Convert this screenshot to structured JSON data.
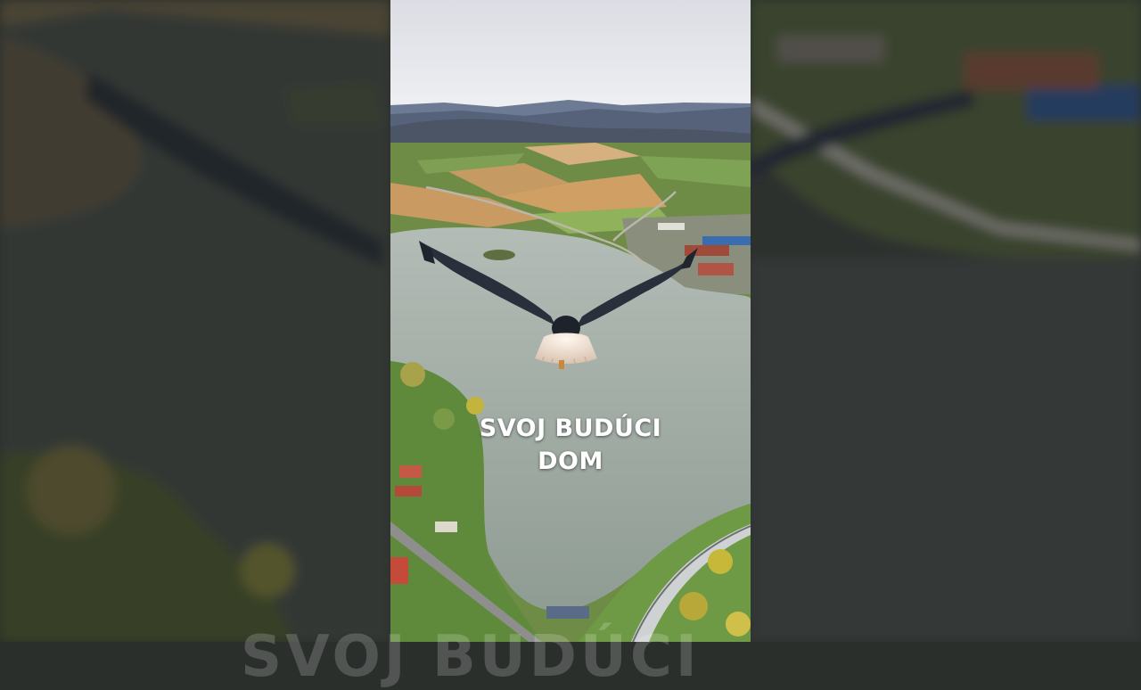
{
  "caption": {
    "line1": "SVOJ BUDÚCI",
    "line2": "DOM"
  },
  "ghost_caption": "SVOJ BUDÚCI",
  "colors": {
    "sky": "#e6e8ee",
    "water": "#a9b4b0",
    "field": "#c99a62",
    "grass": "#6f9a45",
    "eagle_body": "#2d3340",
    "eagle_tail": "#f3e7dc"
  }
}
